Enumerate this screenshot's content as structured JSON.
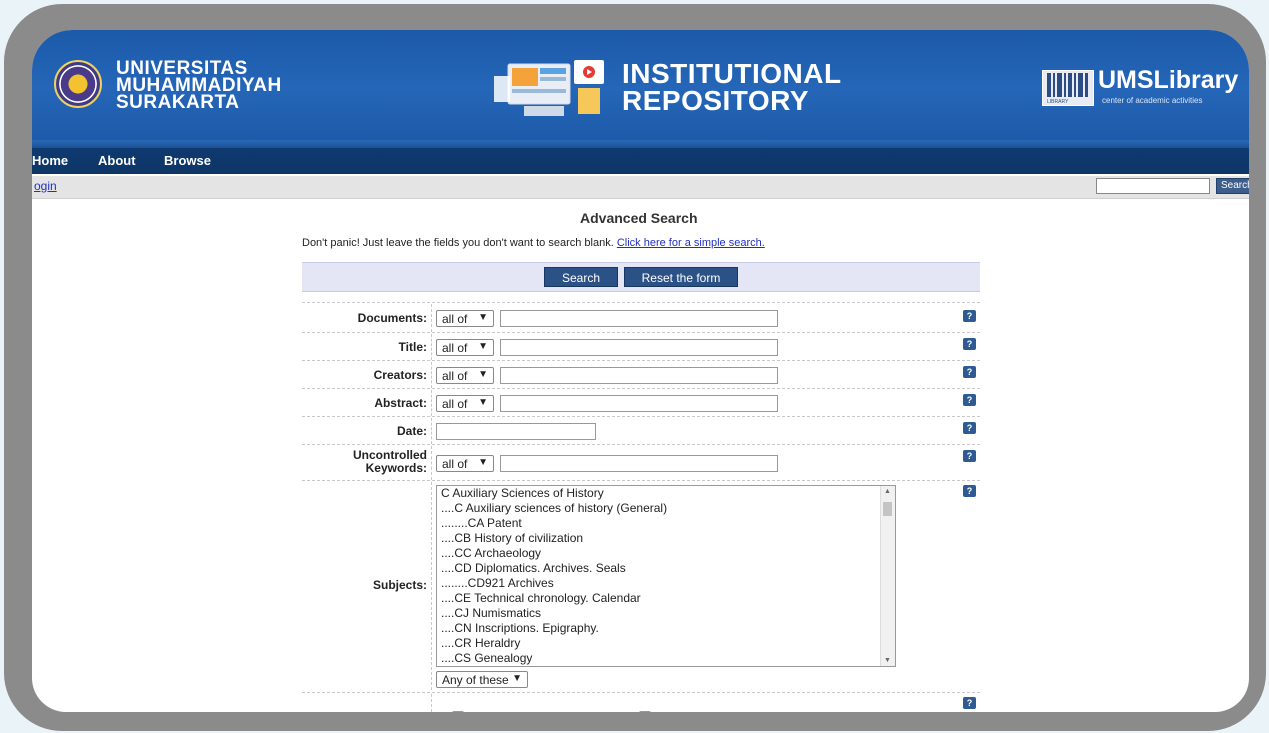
{
  "header": {
    "university_lines": [
      "UNIVERSITAS",
      "MUHAMMADIYAH",
      "SURAKARTA"
    ],
    "repository_lines": [
      "INSTITUTIONAL",
      "REPOSITORY"
    ],
    "library_name": "UMSLibrary",
    "library_tagline": "center of academic activities",
    "library_icon_text": "LIBRARY"
  },
  "nav": {
    "items": [
      "Home",
      "About",
      "Browse"
    ]
  },
  "subbar": {
    "login": "ogin",
    "search_button": "Search",
    "search_value": ""
  },
  "page": {
    "heading": "Advanced Search",
    "notice": "Don't panic! Just leave the fields you don't want to search blank.",
    "simple_link": "Click here for a simple search."
  },
  "actions": {
    "search": "Search",
    "reset": "Reset the form"
  },
  "form": {
    "match_option": "all of",
    "help_label": "?",
    "fields": {
      "documents": "Documents:",
      "title": "Title:",
      "creators": "Creators:",
      "abstract": "Abstract:",
      "date": "Date:",
      "keywords_line1": "Uncontrolled",
      "keywords_line2": "Keywords:",
      "subjects": "Subjects:"
    },
    "subjects_list": [
      "C Auxiliary Sciences of History",
      "....C Auxiliary sciences of history (General)",
      "........CA Patent",
      "....CB History of civilization",
      "....CC Archaeology",
      "....CD Diplomatics. Archives. Seals",
      "........CD921 Archives",
      "....CE Technical chronology. Calendar",
      "....CJ Numismatics",
      "....CN Inscriptions. Epigraphy.",
      "....CR Heraldry",
      "....CS Genealogy"
    ],
    "subjects_match": "Any of these"
  },
  "colors": {
    "banner": "#1f5fb1",
    "nav": "#0f3a70",
    "button": "#2b5287",
    "link": "#2030c0"
  }
}
